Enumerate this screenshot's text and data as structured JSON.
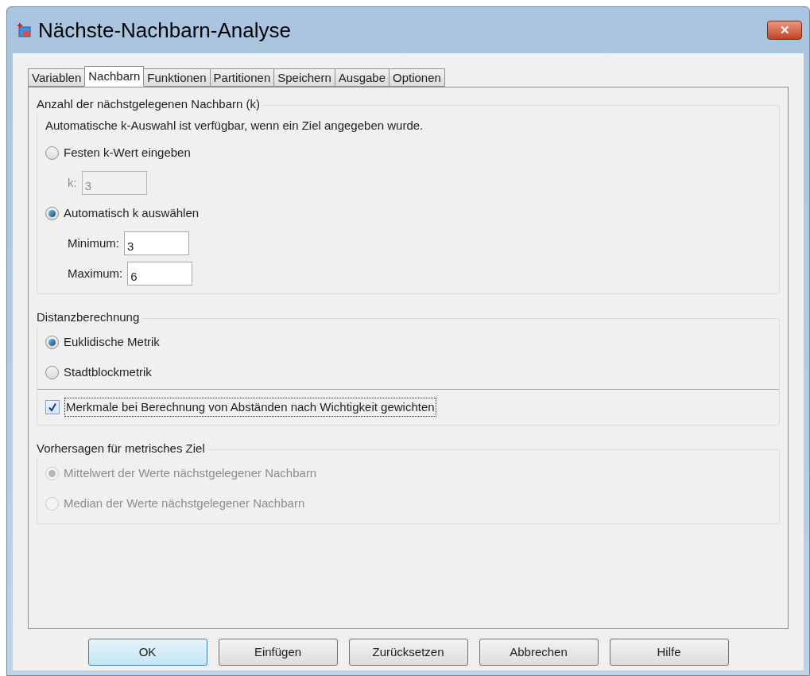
{
  "window": {
    "title": "Nächste-Nachbarn-Analyse",
    "close": "✕"
  },
  "tabs": [
    {
      "label": "Variablen",
      "selected": false
    },
    {
      "label": "Nachbarn",
      "selected": true
    },
    {
      "label": "Funktionen",
      "selected": false
    },
    {
      "label": "Partitionen",
      "selected": false
    },
    {
      "label": "Speichern",
      "selected": false
    },
    {
      "label": "Ausgabe",
      "selected": false
    },
    {
      "label": "Optionen",
      "selected": false
    }
  ],
  "groups": [
    {
      "title": "Anzahl der nächstgelegenen Nachbarn (k)",
      "items": [
        {
          "kind": "text",
          "label": "Automatische k-Auswahl ist verfügbar, wenn ein Ziel angegeben wurde."
        },
        {
          "kind": "radio",
          "label": "Festen k-Wert eingeben",
          "selected": false,
          "disabled": false,
          "children": [
            {
              "kind": "field",
              "label": "k:",
              "value": "3",
              "disabled": true
            }
          ]
        },
        {
          "kind": "radio",
          "label": "Automatisch k auswählen",
          "selected": true,
          "disabled": false,
          "children": [
            {
              "kind": "field",
              "label": "Minimum:",
              "value": "3",
              "disabled": false
            },
            {
              "kind": "field",
              "label": "Maximum:",
              "value": "6",
              "disabled": false
            }
          ]
        }
      ]
    },
    {
      "title": "Distanzberechnung",
      "items": [
        {
          "kind": "radio",
          "label": "Euklidische Metrik",
          "selected": true,
          "disabled": false
        },
        {
          "kind": "radio",
          "label": "Stadtblockmetrik",
          "selected": false,
          "disabled": false
        },
        {
          "kind": "checkbox",
          "label": "Merkmale bei Berechnung von Abständen nach Wichtigkeit gewichten",
          "checked": true
        }
      ]
    },
    {
      "title": "Vorhersagen für metrisches Ziel",
      "items": [
        {
          "kind": "radio",
          "label": "Mittelwert der Werte nächstgelegener Nachbarn",
          "selected": true,
          "disabled": true
        },
        {
          "kind": "radio",
          "label": "Median der Werte nächstgelegener Nachbarn",
          "selected": false,
          "disabled": true
        }
      ]
    }
  ],
  "buttons": [
    {
      "label": "OK",
      "default": true
    },
    {
      "label": "Einfügen",
      "default": false
    },
    {
      "label": "Zurücksetzen",
      "default": false
    },
    {
      "label": "Abbrechen",
      "default": false
    },
    {
      "label": "Hilfe",
      "default": false
    }
  ]
}
